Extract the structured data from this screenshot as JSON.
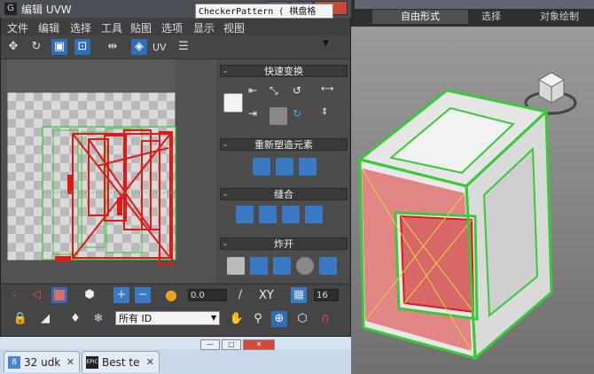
{
  "window": {
    "title": "编辑 UVW",
    "icon": "G",
    "controls": [
      "—",
      "□",
      "✕"
    ]
  },
  "menu": [
    "文件",
    "编辑",
    "选择",
    "工具",
    "贴图",
    "选项",
    "显示",
    "视图"
  ],
  "toolbar": {
    "uv_label": "UV",
    "map_select": "CheckerPattern  ( 棋盘格",
    "map_arrow": "▼"
  },
  "rollouts": [
    {
      "title": "快速变换"
    },
    {
      "title": "重新塑造元素"
    },
    {
      "title": "缝合"
    },
    {
      "title": "炸开"
    }
  ],
  "bottom": {
    "angle_value": "0.0",
    "xy_label": "XY",
    "count_value": "16",
    "id_select": "所有 ID"
  },
  "viewport": {
    "tabs": [
      "自由形式",
      "选择",
      "对象绘制"
    ]
  },
  "taskbar": {
    "window_controls": [
      "—",
      "□",
      "✕"
    ],
    "tabs": [
      {
        "icon": "8",
        "label": "32 udk",
        "close": "✕"
      },
      {
        "icon": "EPIC",
        "label": "Best te",
        "close": "✕"
      }
    ]
  },
  "colors": {
    "uv_red": "#e01818",
    "uv_green": "#39c93a",
    "accent_blue": "#2e6fb5"
  }
}
